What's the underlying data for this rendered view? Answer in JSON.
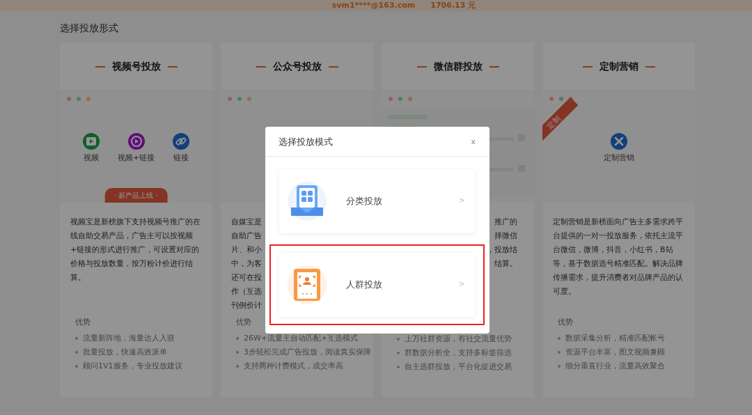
{
  "top_bar": {
    "account": "svm1****@163.com",
    "balance": "1706.13 元"
  },
  "section_title": "选择投放形式",
  "cards": [
    {
      "title": "视频号投放",
      "preview": {
        "kind": "icons",
        "items": [
          {
            "label": "视频",
            "kind": "play"
          },
          {
            "label": "视频+链接",
            "kind": "play-circle"
          },
          {
            "label": "链接",
            "kind": "link"
          }
        ],
        "ribbon": "· 新产品上线 ·"
      },
      "description": "视频宝是新榜旗下支持视频号推广的在线自助交易产品，广告主可以按视频+链接的形式进行推广，可设置对应的价格与投放数量，按万粉计价进行结算。",
      "advantages_title": "优势",
      "advantages": [
        "流量新阵地，海量达人入驻",
        "批量投放，快速高效派单",
        "顾问1V1服务，专业投放建议"
      ]
    },
    {
      "title": "公众号投放",
      "preview": {
        "kind": "blank"
      },
      "description_fragments": {
        "kind": "start",
        "lines": [
          "自媒宝是",
          "自助广告",
          "片、和小",
          "中，为客",
          "还可在投",
          "作（互选",
          "刊例价计"
        ]
      },
      "advantages_title": "优势",
      "advantages": [
        "26W+流量主自动匹配+互选模式",
        "3步轻松完成广告投放，阅读真实保障",
        "支持两种计费模式，成交率高"
      ]
    },
    {
      "title": "微信群投放",
      "preview": {
        "kind": "mockup"
      },
      "description_fragments": {
        "kind": "end",
        "lines": [
          "推广的",
          "择微信",
          "，投放结",
          "结算。"
        ]
      },
      "advantages": [
        "上万社群资源，有社交流量优势",
        "群数据分析全，支持多标签筛选",
        "自主选群投放，平台化促进交易"
      ]
    },
    {
      "title": "定制营销",
      "preview": {
        "kind": "icons",
        "items": [
          {
            "label": "定制营销",
            "kind": "tools"
          }
        ],
        "corner": "定制"
      },
      "description": "定制营销是新榜面向广告主多需求跨平台提供的一对一投放服务，依托主流平台微信，微博，抖音，小红书，B站等，基于数据选号精准匹配。解决品牌传播需求，提升消费者对品牌产品的认可度。",
      "advantages_title": "优势",
      "advantages": [
        "数据采集分析，精准匹配帐号",
        "资源平台丰富，图文视频兼顾",
        "细分垂直行业，流量高效聚合"
      ]
    }
  ],
  "modal": {
    "title": "选择投放模式",
    "close": "x",
    "options": [
      {
        "label": "分类投放",
        "kind": "category",
        "chevron": ">",
        "selected": false
      },
      {
        "label": "人群投放",
        "kind": "audience",
        "chevron": ">",
        "selected": true
      }
    ]
  }
}
